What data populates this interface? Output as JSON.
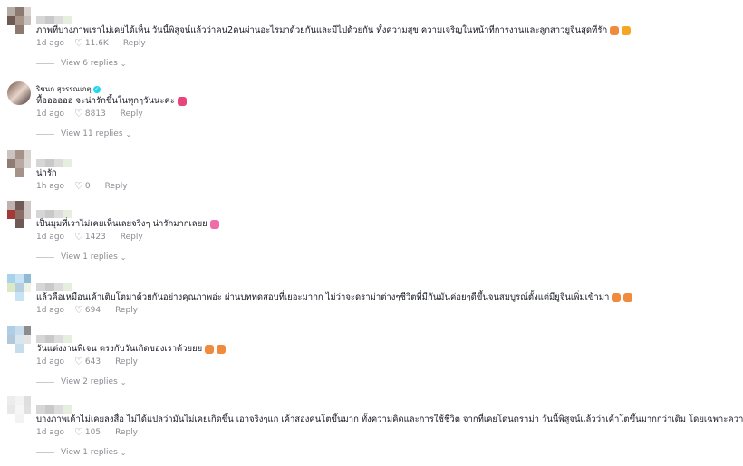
{
  "comments": [
    {
      "text": "ภาพที่บางภาพเราไม่เคยได้เห็น วันนี้พิสูจน์แล้วว่าคน2คนผ่านอะไรมาด้วยกันและมีไปด้วยกัน ทั้งความสุข ความเจริญในหน้าที่การงานและลูกสาวยูจินสุดที่รัก",
      "emojis": [
        "party-heart",
        "grin"
      ],
      "time": "1d ago",
      "likes": "11.6K",
      "reply": "Reply",
      "view_replies": "View 6 replies"
    },
    {
      "username": "ริชนก สุวรรณเกตุ",
      "verified": true,
      "text": "หื้ออออออ จะน่ารักขึ้นในทุกๆวันนะคะ",
      "emojis": [
        "two-hearts"
      ],
      "time": "1d ago",
      "likes": "8813",
      "reply": "Reply",
      "view_replies": "View 11 replies"
    },
    {
      "text": "น่ารัก",
      "emojis": [],
      "time": "1h ago",
      "likes": "0",
      "reply": "Reply"
    },
    {
      "text": "เป็นมุมที่เราไม่เคยเห็นเลยจริงๆ น่ารักมากเลยย",
      "emojis": [
        "pink-heart"
      ],
      "time": "1d ago",
      "likes": "1423",
      "reply": "Reply",
      "view_replies": "View 1 replies"
    },
    {
      "text": "แล้วคือเหมือนเค้าเติบโตมาด้วยกันอย่างคุณภาพอ่ะ ผ่านบททดสอบที่เยอะมากก ไม่ว่าจะดราม่าต่างๆชีวิตที่มีกันมันค่อยๆดีขึ้นจนสมบูรณ์ตั้งแต่มียูจินเพิ่มเข้ามา",
      "emojis": [
        "party-heart",
        "party-heart"
      ],
      "time": "1d ago",
      "likes": "694",
      "reply": "Reply"
    },
    {
      "text": "วันแต่งงานพี่เจน ตรงกับวันเกิดของเราด้วยยย",
      "emojis": [
        "party-heart",
        "party-heart"
      ],
      "time": "1d ago",
      "likes": "643",
      "reply": "Reply",
      "view_replies": "View 2 replies"
    },
    {
      "text": "บางภาพเค้าไม่เคยลงสื่อ ไม่ได้แปลว่ามันไม่เคยเกิดขึ้น เอาจริงๆแก เค้าสองคนโตขึ้นมาก ทั้งความคิดและการใช้ชีวิต จากที่เคยโดนดราม่า วันนี้พิสูจน์แล้วว่าเค้าโตขึ้นมากกว่าเดิม โดยเฉพาะความคิด",
      "emojis": [
        "red-heart"
      ],
      "time": "1d ago",
      "likes": "105",
      "reply": "Reply",
      "view_replies": "View 1 replies"
    }
  ],
  "colors": {
    "text": "#161823",
    "muted": "#8a8b91",
    "verified": "#20d5ec"
  }
}
